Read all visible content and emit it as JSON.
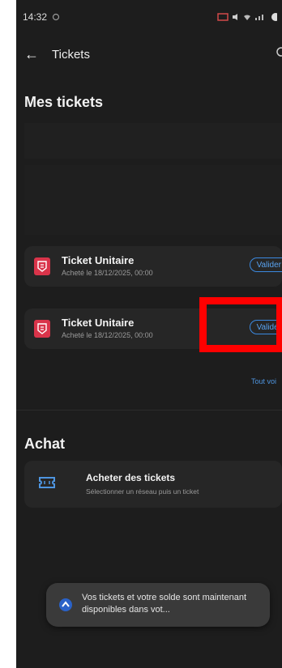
{
  "status_bar": {
    "time": "14:32"
  },
  "app_bar": {
    "title": "Tickets",
    "back_icon": "arrow-left-icon",
    "menu_icon": "more-vertical-icon"
  },
  "mes_tickets": {
    "title": "Mes tickets",
    "tickets": [
      {
        "name": "Ticket Unitaire",
        "purchased": "Acheté le 18/12/2025, 00:00",
        "action": "Valider"
      },
      {
        "name": "Ticket Unitaire",
        "purchased": "Acheté le 18/12/2025, 00:00",
        "action": "Valider"
      }
    ],
    "see_all": "Tout voi"
  },
  "achat": {
    "title": "Achat",
    "buy": {
      "title": "Acheter des tickets",
      "subtitle": "Sélectionner un réseau puis un ticket"
    }
  },
  "toast": {
    "text": "Vos tickets et votre solde sont maintenant disponibles dans vot..."
  },
  "colors": {
    "accent": "#3b89e0",
    "ticket_logo": "#d9344a",
    "highlight": "#ff0000",
    "background": "#1d1d1d"
  }
}
